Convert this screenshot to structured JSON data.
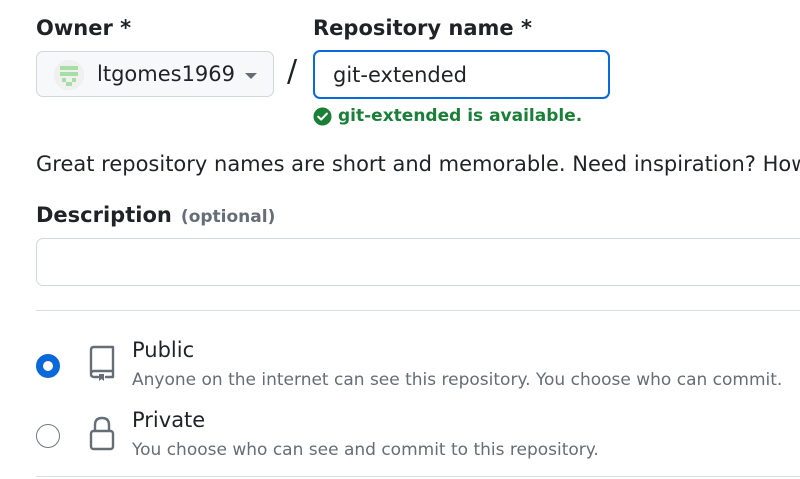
{
  "owner": {
    "label": "Owner *",
    "selected": "ltgomes1969"
  },
  "separator": "/",
  "repository": {
    "label": "Repository name *",
    "value": "git-extended",
    "availability": "git-extended is available."
  },
  "hint": "Great repository names are short and memorable. Need inspiration? How abo",
  "description": {
    "label": "Description",
    "optional": "(optional)",
    "value": ""
  },
  "visibility": {
    "options": [
      {
        "title": "Public",
        "description": "Anyone on the internet can see this repository. You choose who can commit.",
        "selected": true,
        "icon": "repo-icon"
      },
      {
        "title": "Private",
        "description": "You choose who can see and commit to this repository.",
        "selected": false,
        "icon": "lock-icon"
      }
    ]
  },
  "colors": {
    "accent": "#0969da",
    "success": "#1a7f37",
    "muted": "#656d76",
    "border": "#d0d7de"
  }
}
